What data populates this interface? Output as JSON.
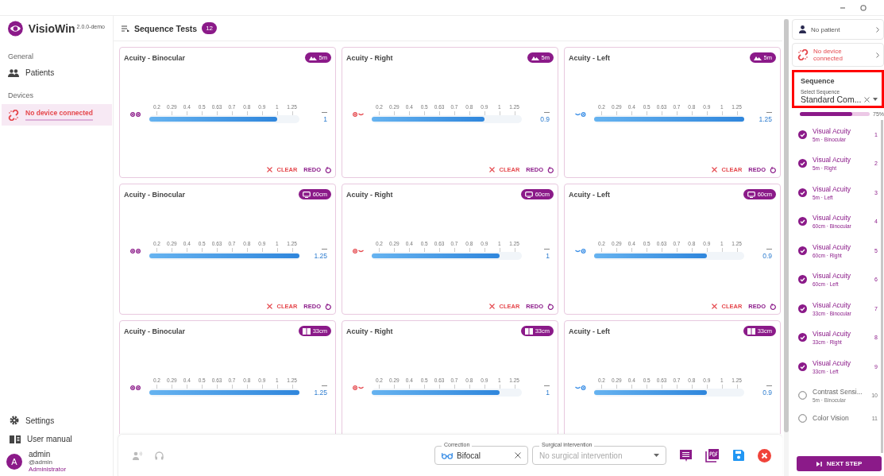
{
  "app": {
    "name": "VisioWin",
    "version": "2.0.0-demo"
  },
  "sidebar": {
    "sections": [
      {
        "heading": "General",
        "items": [
          {
            "kind": "patients",
            "label": "Patients",
            "selected": false
          }
        ]
      },
      {
        "heading": "Devices",
        "items": [
          {
            "kind": "unlinked",
            "label": "No device connected",
            "selected": true
          }
        ]
      }
    ],
    "footer_items": [
      {
        "kind": "settings",
        "label": "Settings"
      },
      {
        "kind": "manual",
        "label": "User manual"
      }
    ],
    "user": {
      "initial": "A",
      "name": "admin",
      "handle": "@admin",
      "role": "Administrator"
    }
  },
  "header": {
    "title": "Sequence Tests",
    "count": "12"
  },
  "tests": [
    {
      "title": "Acuity - Binocular",
      "kind": "binocular",
      "distance": {
        "kind": "far",
        "label": "5m"
      },
      "scale": [
        "0.2",
        "0.29",
        "0.4",
        "0.5",
        "0.63",
        "0.7",
        "0.8",
        "0.9",
        "1",
        "1.25"
      ],
      "level": 0.85,
      "value": "1",
      "clear": "CLEAR",
      "redo": "REDO"
    },
    {
      "title": "Acuity - Right",
      "kind": "right",
      "distance": {
        "kind": "far",
        "label": "5m"
      },
      "scale": [
        "0.2",
        "0.29",
        "0.4",
        "0.5",
        "0.63",
        "0.7",
        "0.8",
        "0.9",
        "1",
        "1.25"
      ],
      "level": 0.75,
      "value": "0.9",
      "clear": "CLEAR",
      "redo": "REDO"
    },
    {
      "title": "Acuity - Left",
      "kind": "left",
      "distance": {
        "kind": "far",
        "label": "5m"
      },
      "scale": [
        "0.2",
        "0.29",
        "0.4",
        "0.5",
        "0.63",
        "0.7",
        "0.8",
        "0.9",
        "1",
        "1.25"
      ],
      "level": 1,
      "value": "1.25",
      "clear": "CLEAR",
      "redo": "REDO"
    },
    {
      "title": "Acuity - Binocular",
      "kind": "binocular",
      "distance": {
        "kind": "intermediate",
        "label": "60cm"
      },
      "scale": [
        "0.2",
        "0.29",
        "0.4",
        "0.5",
        "0.63",
        "0.7",
        "0.8",
        "0.9",
        "1",
        "1.25"
      ],
      "level": 1,
      "value": "1.25",
      "clear": "CLEAR",
      "redo": "REDO"
    },
    {
      "title": "Acuity - Right",
      "kind": "right",
      "distance": {
        "kind": "intermediate",
        "label": "60cm"
      },
      "scale": [
        "0.2",
        "0.29",
        "0.4",
        "0.5",
        "0.63",
        "0.7",
        "0.8",
        "0.9",
        "1",
        "1.25"
      ],
      "level": 0.85,
      "value": "1",
      "clear": "CLEAR",
      "redo": "REDO"
    },
    {
      "title": "Acuity - Left",
      "kind": "left",
      "distance": {
        "kind": "intermediate",
        "label": "60cm"
      },
      "scale": [
        "0.2",
        "0.29",
        "0.4",
        "0.5",
        "0.63",
        "0.7",
        "0.8",
        "0.9",
        "1",
        "1.25"
      ],
      "level": 0.75,
      "value": "0.9",
      "clear": "CLEAR",
      "redo": "REDO"
    },
    {
      "title": "Acuity - Binocular",
      "kind": "binocular",
      "distance": {
        "kind": "near",
        "label": "33cm"
      },
      "scale": [
        "0.2",
        "0.29",
        "0.4",
        "0.5",
        "0.63",
        "0.7",
        "0.8",
        "0.9",
        "1",
        "1.25"
      ],
      "level": 1,
      "value": "1.25"
    },
    {
      "title": "Acuity - Right",
      "kind": "right",
      "distance": {
        "kind": "near",
        "label": "33cm"
      },
      "scale": [
        "0.2",
        "0.29",
        "0.4",
        "0.5",
        "0.63",
        "0.7",
        "0.8",
        "0.9",
        "1",
        "1.25"
      ],
      "level": 0.85,
      "value": "1"
    },
    {
      "title": "Acuity - Left",
      "kind": "left",
      "distance": {
        "kind": "near",
        "label": "33cm"
      },
      "scale": [
        "0.2",
        "0.29",
        "0.4",
        "0.5",
        "0.63",
        "0.7",
        "0.8",
        "0.9",
        "1",
        "1.25"
      ],
      "level": 0.75,
      "value": "0.9"
    }
  ],
  "toolbar": {
    "correction": {
      "label": "Correction",
      "value": "Bifocal"
    },
    "surgical": {
      "label": "Surgical intervention",
      "placeholder": "No surgical intervention"
    }
  },
  "panel": {
    "patient": "No patient",
    "device": "No device connected",
    "sequence": {
      "title": "Sequence",
      "field_label": "Select Sequence",
      "value": "Standard Com...",
      "highlighted": true,
      "level": 0.75,
      "percent": "75%"
    },
    "steps": [
      {
        "title": "Visual Acuity",
        "subtitle": "5m · Binocular",
        "number": "1",
        "checked": true
      },
      {
        "title": "Visual Acuity",
        "subtitle": "5m · Right",
        "number": "2",
        "checked": true
      },
      {
        "title": "Visual Acuity",
        "subtitle": "5m · Left",
        "number": "3",
        "checked": true
      },
      {
        "title": "Visual Acuity",
        "subtitle": "60cm · Binocular",
        "number": "4",
        "checked": true
      },
      {
        "title": "Visual Acuity",
        "subtitle": "60cm · Right",
        "number": "5",
        "checked": true
      },
      {
        "title": "Visual Acuity",
        "subtitle": "60cm · Left",
        "number": "6",
        "checked": true
      },
      {
        "title": "Visual Acuity",
        "subtitle": "33cm · Binocular",
        "number": "7",
        "checked": true
      },
      {
        "title": "Visual Acuity",
        "subtitle": "33cm · Right",
        "number": "8",
        "checked": true
      },
      {
        "title": "Visual Acuity",
        "subtitle": "33cm · Left",
        "number": "9",
        "checked": true
      },
      {
        "title": "Contrast Sensi...",
        "subtitle": "5m · Binocular",
        "number": "10",
        "checked": false
      },
      {
        "title": "Color Vision",
        "number": "11",
        "checked": false
      }
    ],
    "next_button": "NEXT STEP"
  }
}
